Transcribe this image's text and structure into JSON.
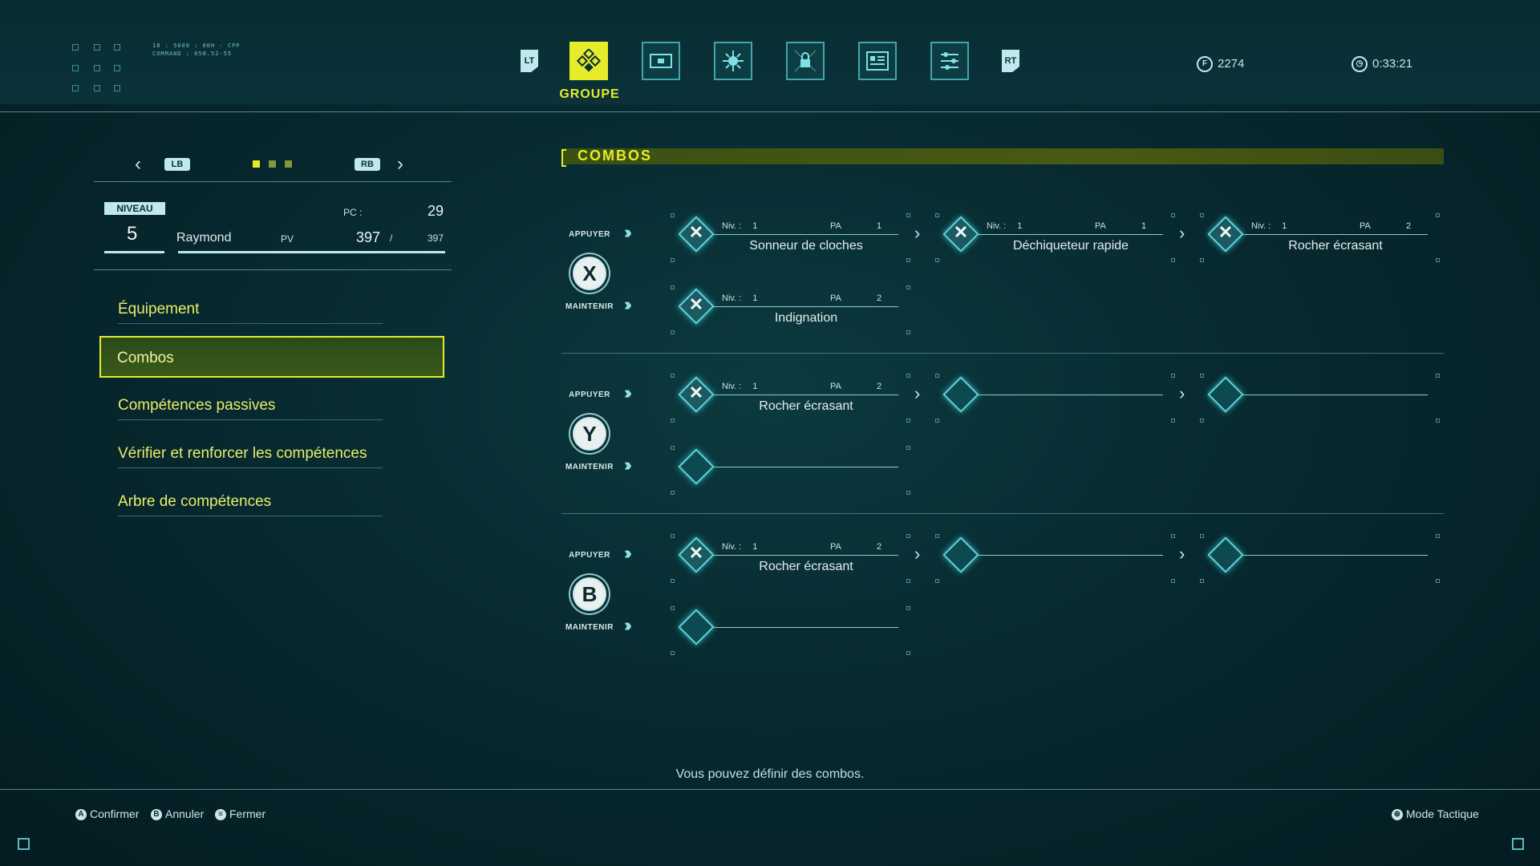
{
  "top": {
    "tabs_side_left": "LT",
    "tabs_side_right": "RT",
    "active_tab_label": "GROUPE",
    "tech_lines": [
      "18 : 5000 : 00H - CPP",
      "COMMAND : 050.52-55"
    ],
    "currency": "2274",
    "currency_icon_glyph": "F",
    "play_time": "0:33:21"
  },
  "character": {
    "pager_left": "LB",
    "pager_right": "RB",
    "niveau_label": "NIVEAU",
    "level": "5",
    "name": "Raymond",
    "pc_label": "PC :",
    "pc_value": "29",
    "pv_label": "PV",
    "pv_current": "397",
    "pv_separator": "/",
    "pv_max": "397",
    "pv_fraction": 1.0
  },
  "menu": [
    {
      "label": "Équipement"
    },
    {
      "label": "Combos",
      "selected": true
    },
    {
      "label": "Compétences passives"
    },
    {
      "label": "Vérifier et renforcer les compétences"
    },
    {
      "label": "Arbre de compétences"
    }
  ],
  "combos": {
    "title": "COMBOS",
    "press_label": "APPUYER",
    "hold_label": "MAINTENIR",
    "niv_label": "Niv. :",
    "pa_label": "PA",
    "groups": [
      {
        "button": "X",
        "press": [
          {
            "niv": "1",
            "pa": "1",
            "name": "Sonneur de cloches"
          },
          {
            "niv": "1",
            "pa": "1",
            "name": "Déchiqueteur rapide"
          },
          {
            "niv": "1",
            "pa": "2",
            "name": "Rocher écrasant"
          }
        ],
        "hold": [
          {
            "niv": "1",
            "pa": "2",
            "name": "Indignation"
          }
        ]
      },
      {
        "button": "Y",
        "press": [
          {
            "niv": "1",
            "pa": "2",
            "name": "Rocher écrasant"
          }
        ],
        "hold": []
      },
      {
        "button": "B",
        "press": [
          {
            "niv": "1",
            "pa": "2",
            "name": "Rocher écrasant"
          }
        ],
        "hold": []
      }
    ]
  },
  "hint": "Vous pouvez définir des combos.",
  "footer": {
    "confirm_icon": "A",
    "confirm": "Confirmer",
    "cancel_icon": "B",
    "cancel": "Annuler",
    "close_icon": "≡",
    "close": "Fermer",
    "tactical": "Mode Tactique"
  },
  "colors": {
    "accent_yellow": "#e6ec2a",
    "cyan": "#5fd0d8",
    "background": "#072a30"
  },
  "icons": [
    "party-icon",
    "map-icon",
    "skills-icon",
    "locked-icon",
    "notes-icon",
    "settings-icon",
    "clock-icon"
  ]
}
